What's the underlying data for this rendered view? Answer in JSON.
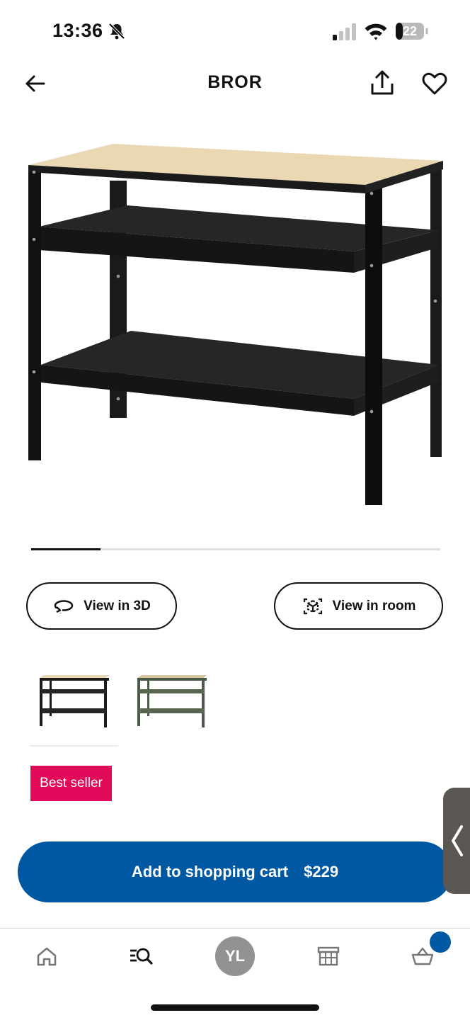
{
  "status_bar": {
    "time": "13:36",
    "battery": "22",
    "icons": [
      "bell-off-icon",
      "signal-icon",
      "wifi-icon",
      "battery-icon"
    ]
  },
  "header": {
    "title": "BROR",
    "icons": [
      "back-arrow-icon",
      "share-icon",
      "heart-icon"
    ]
  },
  "carousel": {
    "progress": 0.17
  },
  "actions": {
    "view_3d_label": "View in 3D",
    "view_room_label": "View in room"
  },
  "badge": {
    "label": "Best seller",
    "color": "#e20a5a"
  },
  "cart": {
    "label": "Add to shopping cart",
    "price": "$229",
    "color": "#0058a3"
  },
  "tab_bar": {
    "profile_initials": "YL",
    "icons": [
      "home-icon",
      "search-list-icon",
      "store-icon",
      "basket-icon"
    ]
  }
}
